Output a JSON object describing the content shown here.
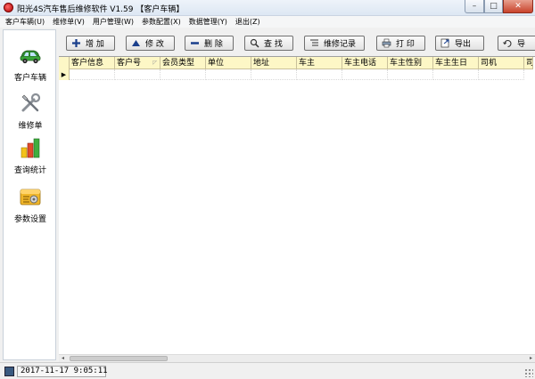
{
  "window": {
    "title": "阳光4S汽车售后维修软件 V1.59 【客户车辆】",
    "controls": {
      "minimize": "–",
      "maximize": "□",
      "close": "✕"
    }
  },
  "menu": [
    "客户车辆(U)",
    "维修单(V)",
    "用户管理(W)",
    "参数配置(X)",
    "数据管理(Y)",
    "退出(Z)"
  ],
  "sidebar": {
    "items": [
      {
        "label": "客户车辆",
        "icon": "car-icon"
      },
      {
        "label": "维修单",
        "icon": "tools-icon"
      },
      {
        "label": "查询统计",
        "icon": "bar-chart-icon"
      },
      {
        "label": "参数设置",
        "icon": "settings-icon"
      }
    ]
  },
  "toolbar": {
    "add": "增 加",
    "edit": "修 改",
    "delete": "删 除",
    "find": "查 找",
    "records": "维修记录",
    "print": "打 印",
    "export": "导出",
    "refresh": "导"
  },
  "grid": {
    "columns": [
      "客户信息",
      "客户号",
      "会员类型",
      "单位",
      "地址",
      "车主",
      "车主电话",
      "车主性别",
      "车主生日",
      "司机",
      "司"
    ],
    "row_indicator": "▶"
  },
  "scrollbar": {
    "left_arrow": "◂",
    "right_arrow": "▸"
  },
  "status": {
    "datetime": "2017-11-17 9:05:11"
  },
  "colors": {
    "header_bg": "#fdf7c6",
    "nav_bg": "#ffffff",
    "close_red": "#c8432b"
  }
}
